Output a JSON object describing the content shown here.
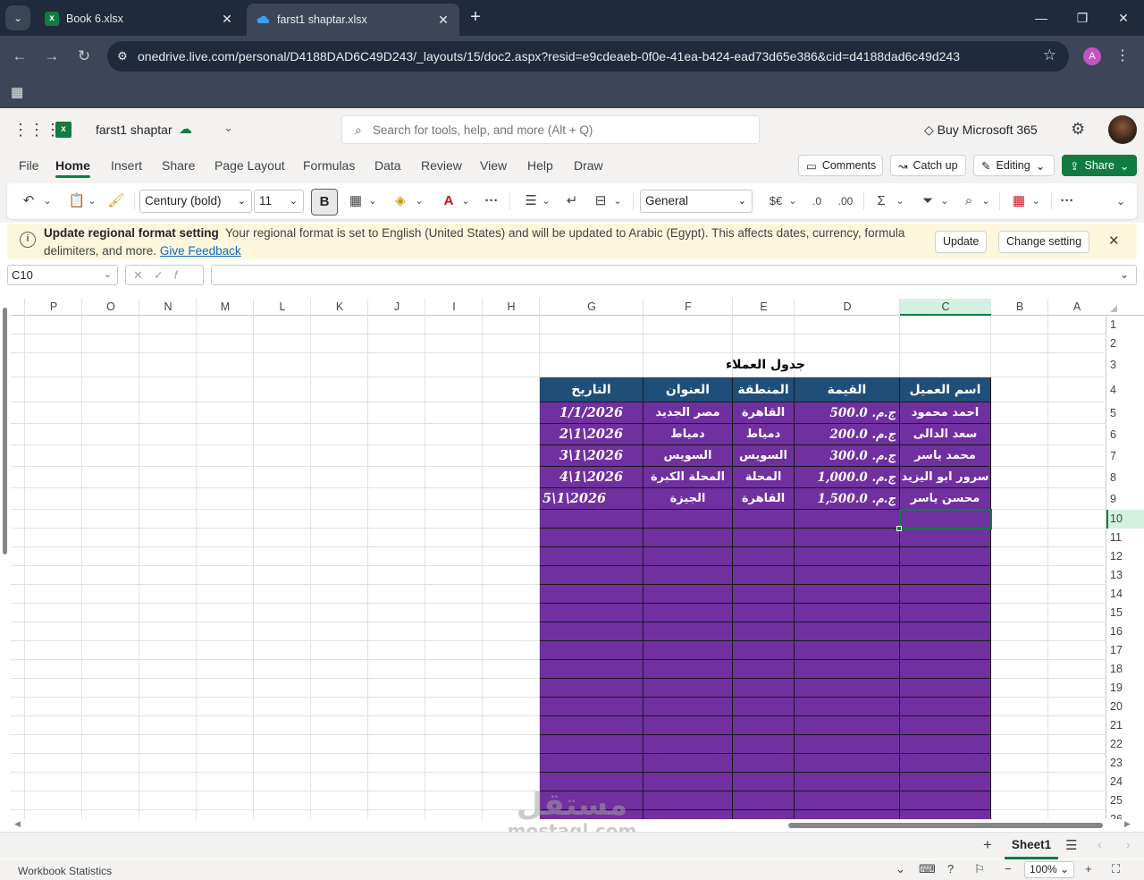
{
  "browser": {
    "tabs": [
      {
        "title": "Book 6.xlsx",
        "active": false
      },
      {
        "title": "farst1 shaptar.xlsx",
        "active": true
      }
    ],
    "url": "onedrive.live.com/personal/D4188DAD6C49D243/_layouts/15/doc2.aspx?resid=e9cdeaeb-0f0e-41ea-b424-ead73d65e386&cid=d4188dad6c49d243",
    "profile_initial": "A"
  },
  "app": {
    "doc_name": "farst1 shaptar",
    "search_placeholder": "Search for tools, help, and more (Alt + Q)",
    "buy_label": "Buy Microsoft 365"
  },
  "menu": {
    "items": [
      "File",
      "Home",
      "Insert",
      "Share",
      "Page Layout",
      "Formulas",
      "Data",
      "Review",
      "View",
      "Help",
      "Draw"
    ],
    "active": "Home",
    "comments": "Comments",
    "catchup": "Catch up",
    "editing": "Editing",
    "share": "Share"
  },
  "ribbon": {
    "font_name": "Century (bold)",
    "font_size": "11",
    "bold": "B",
    "number_format": "General"
  },
  "notice": {
    "title": "Update regional format setting",
    "body": "Your regional format is set to English (United States) and will be updated to Arabic (Egypt). This affects dates, currency, formula delimiters, and more.",
    "link": "Give Feedback",
    "update": "Update",
    "change": "Change setting"
  },
  "formula_bar": {
    "name_box": "C10",
    "formula": ""
  },
  "grid": {
    "columns": [
      "P",
      "O",
      "N",
      "M",
      "L",
      "K",
      "J",
      "I",
      "H",
      "G",
      "F",
      "E",
      "D",
      "C",
      "B",
      "A"
    ],
    "selected_column": "C",
    "rows": [
      "1",
      "2",
      "3",
      "4",
      "5",
      "6",
      "7",
      "8",
      "9",
      "10",
      "11",
      "12",
      "13",
      "14",
      "15",
      "16",
      "17",
      "18",
      "19",
      "20",
      "21",
      "22",
      "23",
      "24",
      "25",
      "26"
    ],
    "selected_row": "10"
  },
  "table": {
    "title": "جدول العملاء",
    "headers": {
      "C": "اسم العميل",
      "D": "القيمة",
      "E": "المنطقة",
      "F": "العنوان",
      "G": "التاريخ"
    },
    "rows": [
      {
        "C": "احمد محمود",
        "D": "ج.م. 500.0",
        "E": "القاهرة",
        "F": "مصر الجديد",
        "G": "1/1/2026"
      },
      {
        "C": "سعد الدالى",
        "D": "ج.م. 200.0",
        "E": "دمياط",
        "F": "دمياط",
        "G": "2\\1\\2026"
      },
      {
        "C": "محمد ياسر",
        "D": "ج.م. 300.0",
        "E": "السويس",
        "F": "السويس",
        "G": "3\\1\\2026"
      },
      {
        "C": "سرور ابو اليزيد",
        "D": "ج.م. 1,000.0",
        "E": "المحلة",
        "F": "المحلة الكبرة",
        "G": "4\\1\\2026"
      },
      {
        "C": "محسن ياسر",
        "D": "ج.م. 1,500.0",
        "E": "القاهرة",
        "F": "الجيزة",
        "G": "5\\1\\2026"
      }
    ],
    "header_color": "#1f4e79",
    "fill_color": "#7030a0"
  },
  "sheets": {
    "active": "Sheet1"
  },
  "status": {
    "left": "Workbook Statistics",
    "zoom": "100%"
  },
  "watermark": {
    "arabic": "مستقل",
    "latin": "mostaql.com"
  },
  "colors": {
    "accent": "#107c41",
    "chrome": "#1f2a3c"
  }
}
